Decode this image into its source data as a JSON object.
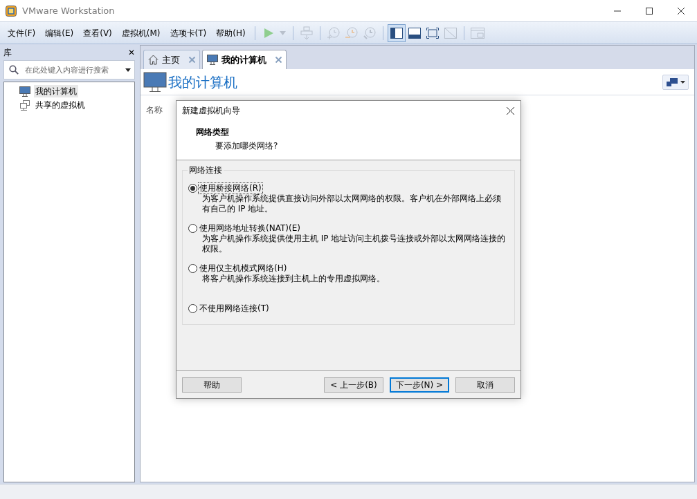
{
  "window": {
    "title": "VMware Workstation"
  },
  "menu": [
    "文件(F)",
    "编辑(E)",
    "查看(V)",
    "虚拟机(M)",
    "选项卡(T)",
    "帮助(H)"
  ],
  "toolbar": [
    {
      "kind": "play",
      "disabled": false,
      "selected": false
    },
    {
      "kind": "dropdown",
      "disabled": true,
      "selected": false
    },
    {
      "kind": "send-keys",
      "disabled": true,
      "selected": false
    },
    {
      "kind": "snapshot-take",
      "disabled": true,
      "selected": false
    },
    {
      "kind": "snapshot-revert",
      "disabled": true,
      "selected": false
    },
    {
      "kind": "snapshot-manage",
      "disabled": true,
      "selected": false
    },
    {
      "kind": "sidebar",
      "disabled": false,
      "selected": true
    },
    {
      "kind": "thumbnail",
      "disabled": false,
      "selected": false
    },
    {
      "kind": "fullscreen",
      "disabled": false,
      "selected": false
    },
    {
      "kind": "unity",
      "disabled": true,
      "selected": false
    },
    {
      "kind": "console",
      "disabled": true,
      "selected": false
    }
  ],
  "library": {
    "title": "库",
    "close": "✕",
    "search": {
      "placeholder": "在此处键入内容进行搜索"
    },
    "items": [
      {
        "label": "我的计算机",
        "kind": "computer",
        "selected": true
      },
      {
        "label": "共享的虚拟机",
        "kind": "shared",
        "selected": false
      }
    ]
  },
  "tabs": [
    {
      "label": "主页",
      "kind": "home",
      "selected": false
    },
    {
      "label": "我的计算机",
      "kind": "computer",
      "selected": true
    }
  ],
  "page": {
    "title": "我的计算机",
    "column": "名称"
  },
  "dialog": {
    "title": "新建虚拟机向导",
    "heading": "网络类型",
    "subheading": "要添加哪类网络?",
    "group": "网络连接",
    "options": [
      {
        "label": "使用桥接网络(R)",
        "description": "为客户机操作系统提供直接访问外部以太网网络的权限。客户机在外部网络上必须有自己的 IP 地址。",
        "selected": true
      },
      {
        "label": "使用网络地址转换(NAT)(E)",
        "description": "为客户机操作系统提供使用主机 IP 地址访问主机拨号连接或外部以太网网络连接的权限。",
        "selected": false
      },
      {
        "label": "使用仅主机模式网络(H)",
        "description": "将客户机操作系统连接到主机上的专用虚拟网络。",
        "selected": false
      },
      {
        "label": "不使用网络连接(T)",
        "selected": false
      }
    ],
    "help": "帮助",
    "buttons": [
      {
        "label": "< 上一步(B)",
        "default": false
      },
      {
        "label": "下一步(N) >",
        "default": true
      },
      {
        "label": "取消",
        "default": false
      }
    ]
  }
}
